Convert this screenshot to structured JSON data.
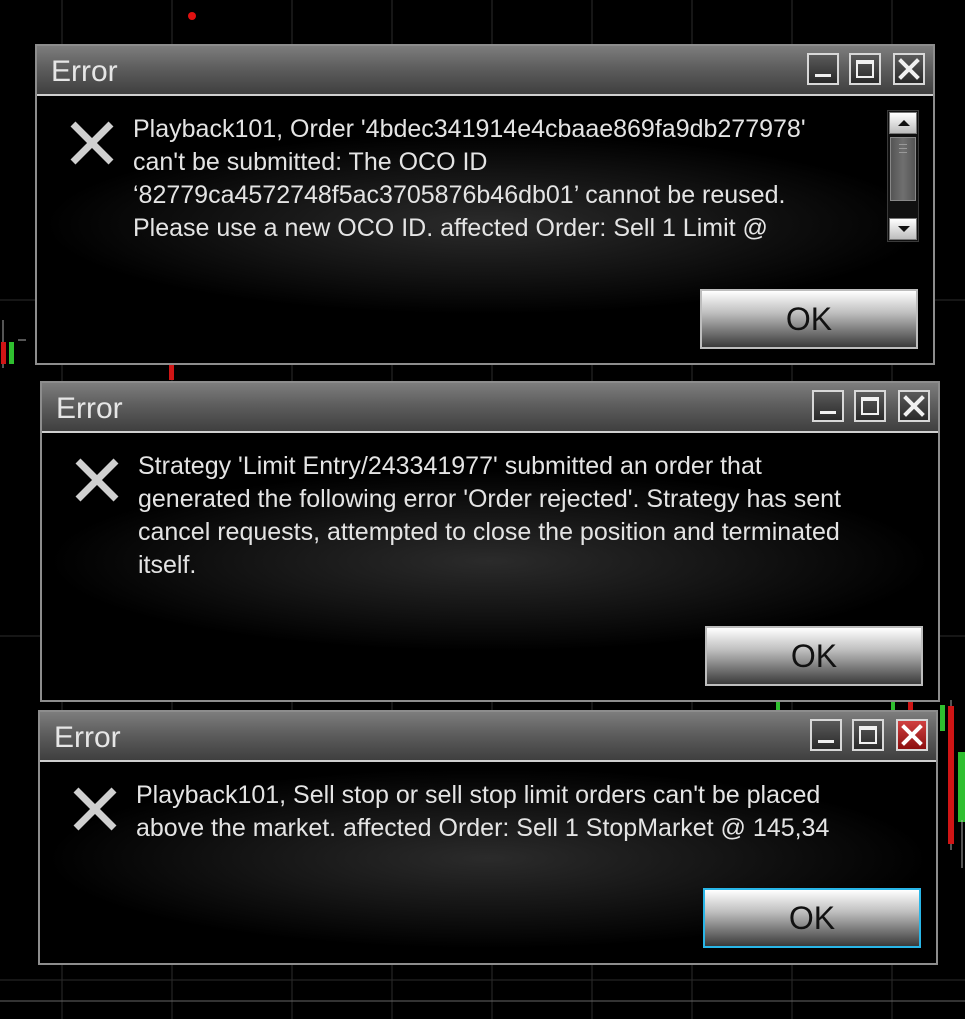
{
  "dialogs": [
    {
      "title": "Error",
      "message_lines": [
        "Playback101, Order '4bdec341914e4cbaae869fa9db277978'",
        "can't be submitted: The OCO ID",
        "‘82779ca4572748f5ac3705876b46db01’ cannot be reused.",
        "Please use a new OCO ID. affected Order: Sell 1 Limit @"
      ],
      "ok_label": "OK"
    },
    {
      "title": "Error",
      "message_lines": [
        "Strategy 'Limit Entry/243341977' submitted an order that",
        "generated the following error 'Order rejected'. Strategy has sent",
        "cancel requests, attempted to close the position and terminated",
        "itself."
      ],
      "ok_label": "OK"
    },
    {
      "title": "Error",
      "message_lines": [
        "Playback101, Sell stop or sell stop limit orders can't be placed",
        "above the market. affected Order: Sell 1 StopMarket @ 145,34"
      ],
      "ok_label": "OK"
    }
  ],
  "icons": {
    "error": "error-x-icon",
    "minimize": "minimize-icon",
    "maximize": "maximize-icon",
    "close": "close-icon",
    "scroll_up": "scroll-up-arrow-icon",
    "scroll_down": "scroll-down-arrow-icon"
  },
  "colors": {
    "background": "#000000",
    "titlebar": "#5e5e5e",
    "text": "#e4e4e4",
    "close_active": "#c02020",
    "ok_focus": "#29b6e8",
    "candle_up": "#2fbf2f",
    "candle_down": "#d01515"
  }
}
